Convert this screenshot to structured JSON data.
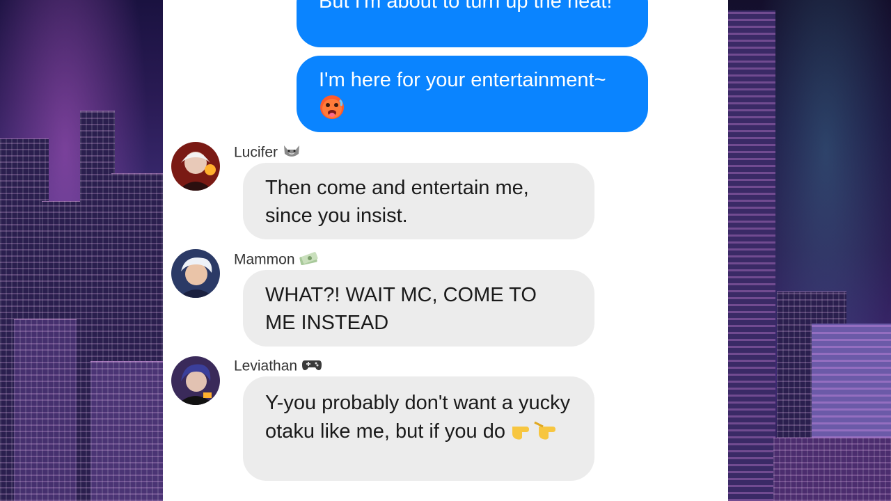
{
  "messages_out": [
    {
      "text": "But I'm about to turn up the heat!"
    },
    {
      "text": "I'm here for your entertainment~",
      "emoji": "hot-face-emoji"
    }
  ],
  "messages_in": [
    {
      "sender": "Lucifer",
      "sender_icon": "wolf-emoji",
      "text": "Then come and entertain me, since you insist."
    },
    {
      "sender": "Mammon",
      "sender_icon": "money-emoji",
      "text": "WHAT?! WAIT MC, COME TO ME INSTEAD"
    },
    {
      "sender": "Leviathan",
      "sender_icon": "game-controller-emoji",
      "text": "Y-you probably don't want a yucky otaku like me, but if you do",
      "emoji": "pointing-hands-emoji"
    }
  ],
  "colors": {
    "outgoing_bubble": "#0a84ff",
    "incoming_bubble": "#ececec",
    "chat_background": "#ffffff"
  }
}
